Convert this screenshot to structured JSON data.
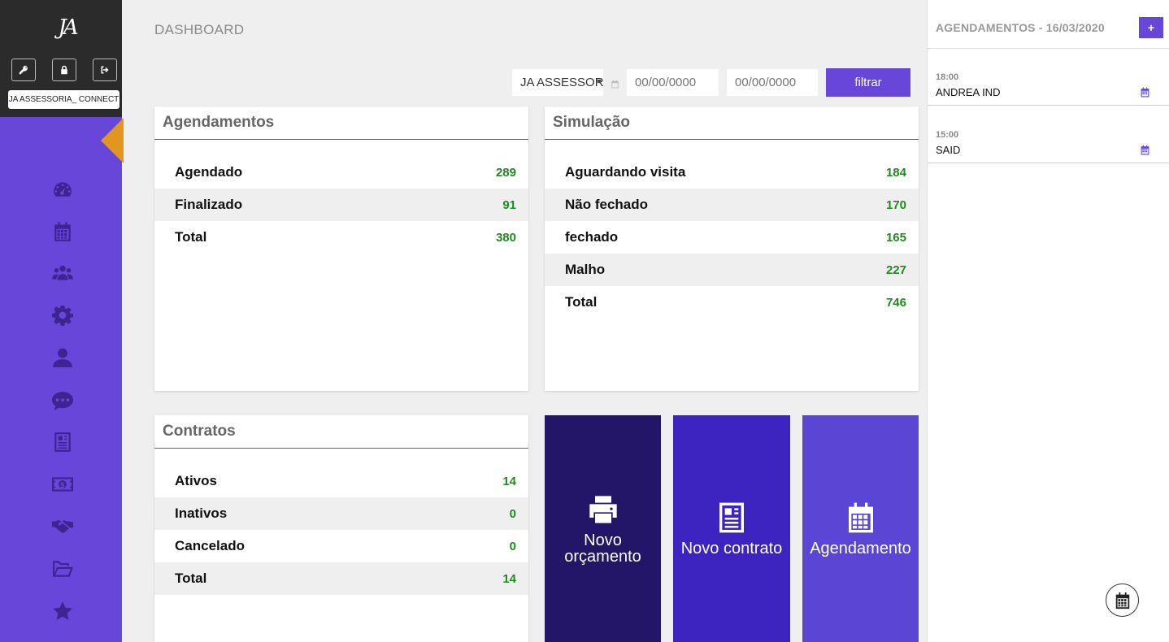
{
  "sidebar": {
    "logo_text": "JA",
    "tooltip": "JA ASSESSORIA_ CONNECT",
    "top_buttons": [
      "key-icon",
      "lock-icon",
      "logout-icon"
    ],
    "nav_icons": [
      "dashboard-icon",
      "calendar-icon",
      "users-icon",
      "gear-icon",
      "user-icon",
      "chat-icon",
      "document-icon",
      "money-icon",
      "handshake-icon",
      "folder-open-icon",
      "star-icon"
    ],
    "accent_color": "#e0961f",
    "bg_color": "#6647d9"
  },
  "header": {
    "title": "DASHBOARD"
  },
  "filters": {
    "select_value": "JA ASSESSORI",
    "date_from_placeholder": "00/00/0000",
    "date_to_placeholder": "00/00/0000",
    "button_label": "filtrar"
  },
  "cards": {
    "agendamentos": {
      "title": "Agendamentos",
      "rows": [
        {
          "label": "Agendado",
          "value": "289"
        },
        {
          "label": "Finalizado",
          "value": "91"
        },
        {
          "label": "Total",
          "value": "380"
        }
      ]
    },
    "simulacao": {
      "title": "Simulação",
      "rows": [
        {
          "label": "Aguardando visita",
          "value": "184"
        },
        {
          "label": "Não fechado",
          "value": "170"
        },
        {
          "label": "fechado",
          "value": "165"
        },
        {
          "label": "Malho",
          "value": "227"
        },
        {
          "label": "Total",
          "value": "746"
        }
      ]
    },
    "contratos": {
      "title": "Contratos",
      "rows": [
        {
          "label": "Ativos",
          "value": "14"
        },
        {
          "label": "Inativos",
          "value": "0"
        },
        {
          "label": "Cancelado",
          "value": "0"
        },
        {
          "label": "Total",
          "value": "14"
        }
      ]
    }
  },
  "tiles": [
    {
      "label_line1": "Novo",
      "label_line2": "orçamento",
      "icon": "printer-icon",
      "color": "#231568"
    },
    {
      "label": "Novo contrato",
      "icon": "contract-icon",
      "color": "#3d24c0"
    },
    {
      "label": "Agendamento",
      "icon": "calendar-icon",
      "color": "#5b45d4"
    }
  ],
  "right_panel": {
    "title": "AGENDAMENTOS - 16/03/2020",
    "add_label": "+",
    "items": [
      {
        "time": "18:00",
        "name": "ANDREA IND"
      },
      {
        "time": "15:00",
        "name": "SAID"
      }
    ]
  }
}
